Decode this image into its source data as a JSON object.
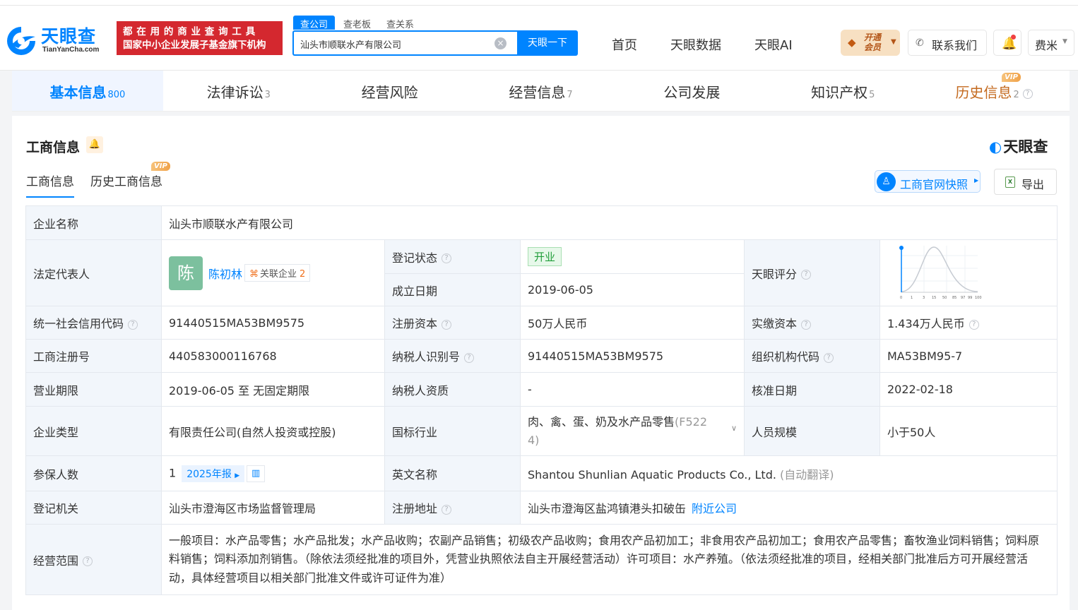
{
  "header": {
    "logo_cn": "天眼查",
    "logo_en": "TianYanCha.com",
    "banner_line1": "都在用的商业查询工具",
    "banner_line2": "国家中小企业发展子基金旗下机构",
    "search_tabs": [
      "查公司",
      "查老板",
      "查关系"
    ],
    "search_value": "汕头市顺联水产有限公司",
    "search_button": "天眼一下",
    "nav": [
      "首页",
      "天眼数据",
      "天眼AI"
    ],
    "vip_line1": "开通",
    "vip_line2": "会员",
    "contact": "联系我们",
    "user": "费米"
  },
  "category_tabs": [
    {
      "label": "基本信息",
      "count": "800"
    },
    {
      "label": "法律诉讼",
      "count": "3"
    },
    {
      "label": "经营风险",
      "count": ""
    },
    {
      "label": "经营信息",
      "count": "7"
    },
    {
      "label": "公司发展",
      "count": ""
    },
    {
      "label": "知识产权",
      "count": "5"
    },
    {
      "label": "历史信息",
      "count": "2",
      "badge": "VIP"
    }
  ],
  "section": {
    "title": "工商信息",
    "brand": "天眼查",
    "sub_tabs": [
      "工商信息",
      "历史工商信息"
    ],
    "sub_vip": "VIP",
    "snapshot_button": "工商官网快照",
    "export_button": "导出"
  },
  "info": {
    "company_name_label": "企业名称",
    "company_name": "汕头市顺联水产有限公司",
    "legal_rep_label": "法定代表人",
    "legal_rep_avatar": "陈",
    "legal_rep": "陈初林",
    "related_label": "关联企业",
    "related_count": "2",
    "reg_status_label": "登记状态",
    "reg_status": "开业",
    "found_date_label": "成立日期",
    "found_date": "2019-06-05",
    "score_label": "天眼评分",
    "score_ticks": [
      "0",
      "1",
      "3",
      "15",
      "50",
      "85",
      "97",
      "99",
      "100"
    ],
    "credit_code_label": "统一社会信用代码",
    "credit_code": "91440515MA53BM9575",
    "reg_capital_label": "注册资本",
    "reg_capital": "50万人民币",
    "paid_capital_label": "实缴资本",
    "paid_capital": "1.434万人民币",
    "reg_no_label": "工商注册号",
    "reg_no": "440583000116768",
    "taxpayer_id_label": "纳税人识别号",
    "taxpayer_id": "91440515MA53BM9575",
    "org_code_label": "组织机构代码",
    "org_code": "MA53BM95-7",
    "term_label": "营业期限",
    "term": "2019-06-05 至 无固定期限",
    "taxpayer_qual_label": "纳税人资质",
    "taxpayer_qual": "-",
    "approve_date_label": "核准日期",
    "approve_date": "2022-02-18",
    "type_label": "企业类型",
    "type": "有限责任公司(自然人投资或控股)",
    "industry_label": "国标行业",
    "industry": "肉、禽、蛋、奶及水产品零售",
    "industry_code_a": "(F522",
    "industry_code_b": "4)",
    "staff_label": "人员规模",
    "staff": "小于50人",
    "insured_label": "参保人数",
    "insured": "1",
    "report_tag": "2025年报",
    "en_name_label": "英文名称",
    "en_name": "Shantou Shunlian Aquatic Products Co., Ltd.",
    "en_name_note": "(自动翻译)",
    "authority_label": "登记机关",
    "authority": "汕头市澄海区市场监督管理局",
    "address_label": "注册地址",
    "address": "汕头市澄海区盐鸿镇港头扣破缶",
    "nearby": "附近公司",
    "scope_label": "经营范围",
    "scope": "一般项目：水产品零售；水产品批发；水产品收购；农副产品销售；初级农产品收购；食用农产品初加工；非食用农产品初加工；食用农产品零售；畜牧渔业饲料销售；饲料原料销售；饲料添加剂销售。（除依法须经批准的项目外，凭营业执照依法自主开展经营活动）许可项目：水产养殖。（依法须经批准的项目，经相关部门批准后方可开展经营活动，具体经营项目以相关部门批准文件或许可证件为准）"
  },
  "colors": {
    "accent": "#0084ff",
    "banner": "#d4282f",
    "status_green": "#219e3a"
  }
}
